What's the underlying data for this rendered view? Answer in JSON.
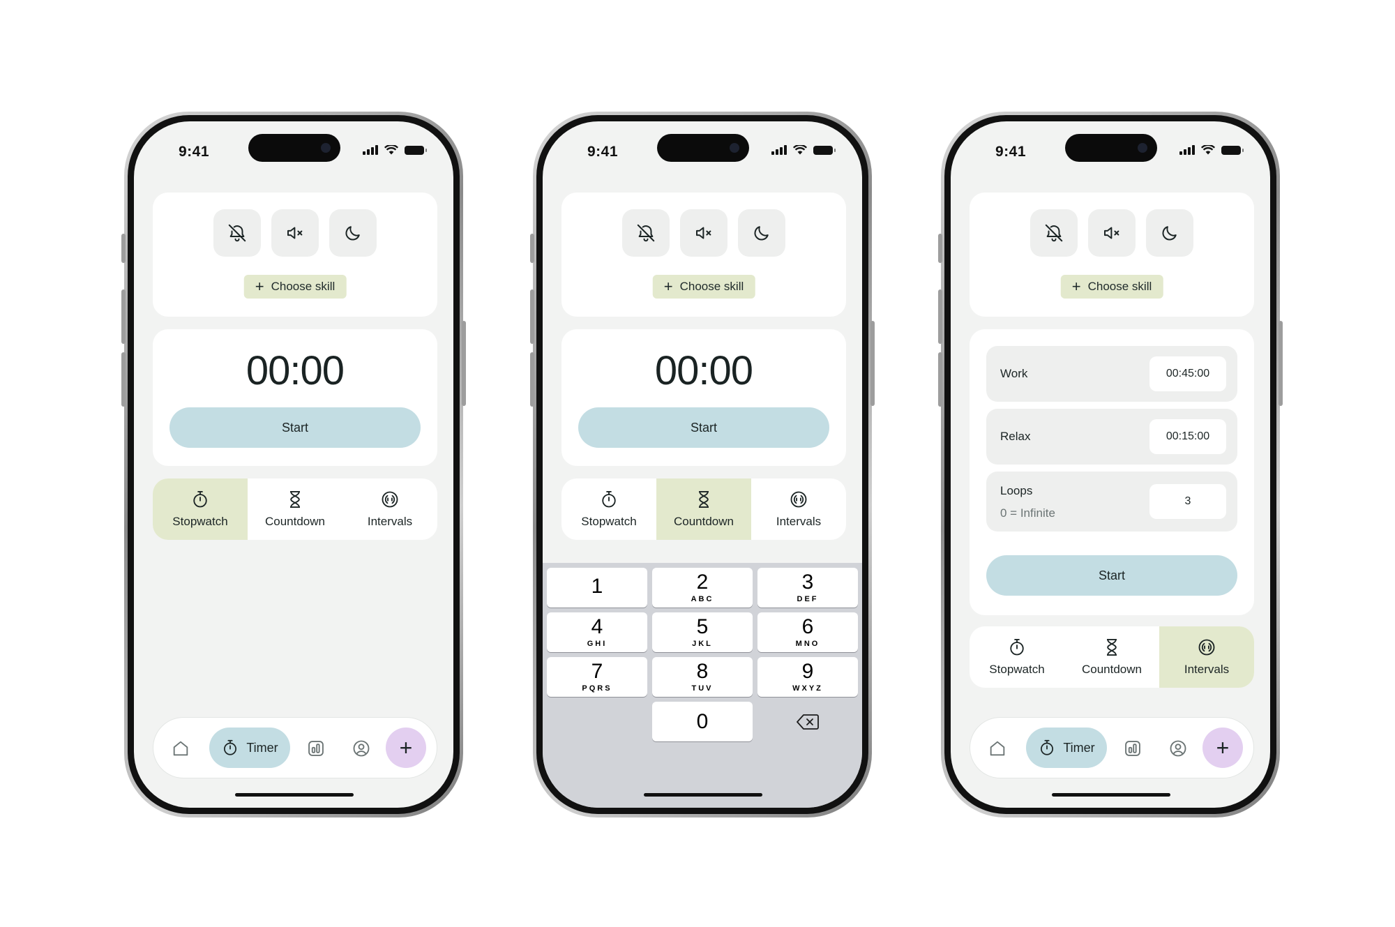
{
  "status": {
    "time": "9:41"
  },
  "quick": {
    "choose_skill": "Choose skill",
    "plus": "+"
  },
  "timer": {
    "display": "00:00",
    "start": "Start"
  },
  "modes": {
    "stopwatch": "Stopwatch",
    "countdown": "Countdown",
    "intervals": "Intervals"
  },
  "tabbar": {
    "timer": "Timer",
    "add": "+"
  },
  "keypad": {
    "rows": [
      [
        {
          "n": "1",
          "l": ""
        },
        {
          "n": "2",
          "l": "ABC"
        },
        {
          "n": "3",
          "l": "DEF"
        }
      ],
      [
        {
          "n": "4",
          "l": "GHI"
        },
        {
          "n": "5",
          "l": "JKL"
        },
        {
          "n": "6",
          "l": "MNO"
        }
      ],
      [
        {
          "n": "7",
          "l": "PQRS"
        },
        {
          "n": "8",
          "l": "TUV"
        },
        {
          "n": "9",
          "l": "WXYZ"
        }
      ]
    ],
    "zero": "0"
  },
  "intervals": {
    "work_label": "Work",
    "work_value": "00:45:00",
    "relax_label": "Relax",
    "relax_value": "00:15:00",
    "loops_label": "Loops",
    "loops_hint": "0 = Infinite",
    "loops_value": "3"
  },
  "colors": {
    "accent_green": "#e3e9cd",
    "accent_blue": "#c3dde3",
    "accent_purple": "#e3cff0",
    "screen_bg": "#f2f3f2"
  },
  "icons": {
    "quick": [
      "bell-off-icon",
      "volume-mute-icon",
      "moon-icon"
    ],
    "modes": [
      "stopwatch-icon",
      "hourglass-icon",
      "intervals-icon"
    ],
    "tabbar": [
      "home-icon",
      "stopwatch-icon",
      "stats-icon",
      "profile-icon",
      "plus-icon"
    ],
    "keypad": [
      "backspace-icon"
    ]
  }
}
